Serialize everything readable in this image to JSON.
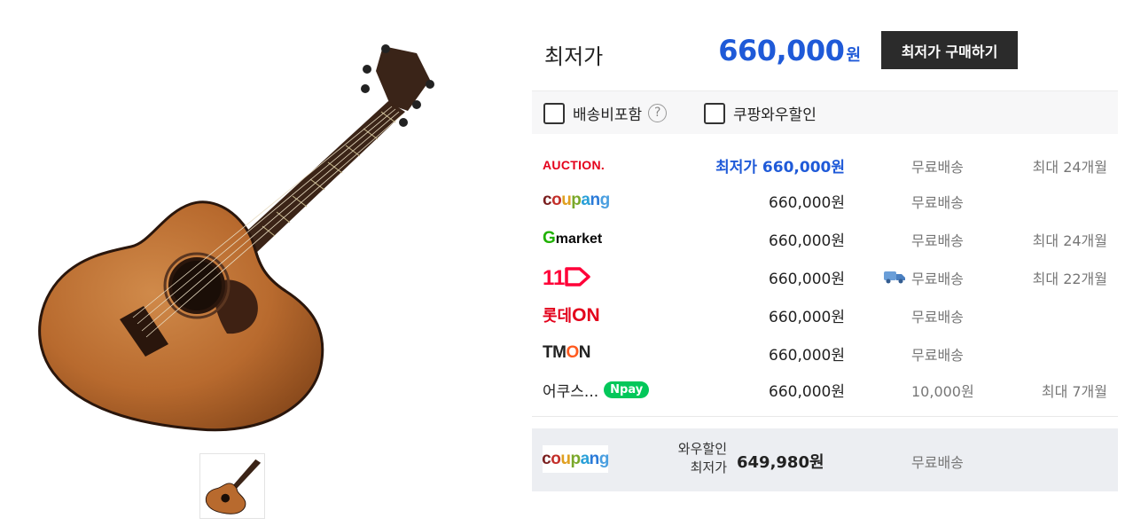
{
  "product": {
    "main_image_name": "acoustic-guitar-image",
    "thumbnail_name": "guitar-thumbnail"
  },
  "summary": {
    "lowest_label": "최저가",
    "lowest_price": "660,000",
    "currency": "원",
    "buy_button": "최저가 구매하기"
  },
  "filters": [
    {
      "label": "배송비포함",
      "checked": false,
      "help": "?"
    },
    {
      "label": "쿠팡와우할인",
      "checked": false
    }
  ],
  "offers": [
    {
      "seller": "AUCTION.",
      "price_prefix": "최저가 ",
      "price": "660,000원",
      "shipping": "무료배송",
      "installment": "최대 24개월",
      "highlight": true
    },
    {
      "seller": "coupang",
      "price": "660,000원",
      "shipping": "무료배송",
      "installment": ""
    },
    {
      "seller": "Gmarket",
      "price": "660,000원",
      "shipping": "무료배송",
      "installment": "최대 24개월"
    },
    {
      "seller": "11번가",
      "price": "660,000원",
      "shipping": "무료배송",
      "installment": "최대 22개월",
      "truck_icon": "truck-icon"
    },
    {
      "seller": "롯데ON",
      "price": "660,000원",
      "shipping": "무료배송",
      "installment": ""
    },
    {
      "seller": "TMON",
      "price": "660,000원",
      "shipping": "무료배송",
      "installment": ""
    },
    {
      "seller": "어쿠스...",
      "badge": "pay",
      "price": "660,000원",
      "shipping": "10,000원",
      "installment": "최대 7개월"
    }
  ],
  "wow": {
    "seller": "coupang",
    "label_line1": "와우할인",
    "label_line2": "최저가",
    "price": "649,980원",
    "shipping": "무료배송"
  },
  "colors": {
    "accent_blue": "#1f5ad8",
    "button_dark": "#2b2b2b",
    "auction_red": "#e4001b",
    "npay_green": "#03c75a"
  }
}
